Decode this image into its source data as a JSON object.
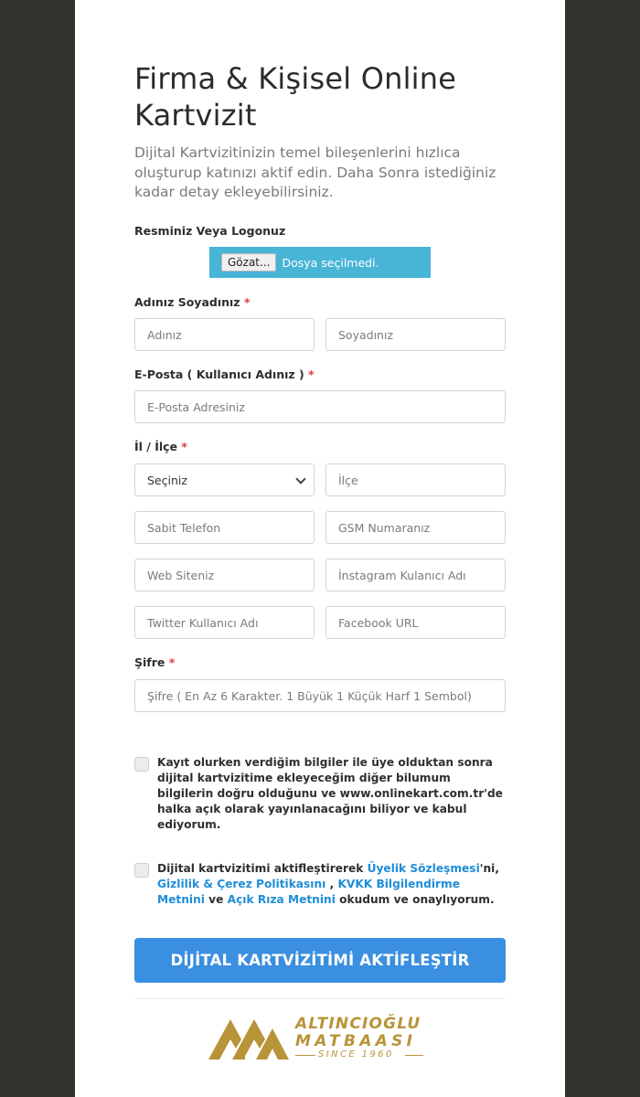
{
  "header": {
    "title": "Firma & Kişisel Online Kartvizit",
    "subtitle": "Dijital Kartvizitinizin temel bileşenlerini hızlıca oluşturup katınızı aktif edin. Daha Sonra istediğiniz kadar detay ekleyebilirsiniz."
  },
  "form": {
    "logo_label": "Resminiz Veya Logonuz",
    "file_button": "Gözat...",
    "file_status": "Dosya seçilmedi.",
    "required_mark": "*",
    "name_label": "Adınız Soyadınız",
    "first_name_placeholder": "Adınız",
    "last_name_placeholder": "Soyadınız",
    "email_label": "E-Posta ( Kullanıcı Adınız )",
    "email_placeholder": "E-Posta Adresiniz",
    "location_label": "İl / İlçe",
    "city_selected": "Seçiniz",
    "district_placeholder": "İlçe",
    "phone_placeholder": "Sabit Telefon",
    "gsm_placeholder": "GSM Numaranız",
    "website_placeholder": "Web Siteniz",
    "instagram_placeholder": "İnstagram Kulanıcı Adı",
    "twitter_placeholder": "Twitter Kullanıcı Adı",
    "facebook_placeholder": "Facebook URL",
    "password_label": "Şifre",
    "password_placeholder": "Şifre ( En Az 6 Karakter. 1 Büyük 1 Küçük Harf 1 Sembol)"
  },
  "consent1": {
    "text": "Kayıt olurken verdiğim bilgiler ile üye olduktan sonra dijital kartvizitime ekleyeceğim diğer bilumum bilgilerin doğru olduğunu ve www.onlinekart.com.tr'de halka açık olarak yayınlanacağını biliyor ve kabul ediyorum."
  },
  "consent2": {
    "prefix": "Dijital kartvizitimi aktifleştirerek ",
    "link1": "Üyelik Sözleşmesi",
    "part1": "'ni, ",
    "link2": "Gizlilik & Çerez Politikasını",
    "part2": " , ",
    "link3": "KVKK Bilgilendirme Metnini",
    "part3": " ve ",
    "link4": "Açık Rıza Metnini",
    "suffix": " okudum ve onaylıyorum."
  },
  "submit_label": "DİJİTAL KARTVİZİTİMİ AKTİFLEŞTİR",
  "logo": {
    "line1": "ALTINCIOĞLU",
    "line2": "MATBAASI",
    "line3": "SINCE 1960",
    "color": "#b89438"
  },
  "colors": {
    "background": "#33322e",
    "accent": "#3a8fe0",
    "file_box": "#48b4d6",
    "link": "#1e8dd8",
    "required": "#e03a3a"
  }
}
